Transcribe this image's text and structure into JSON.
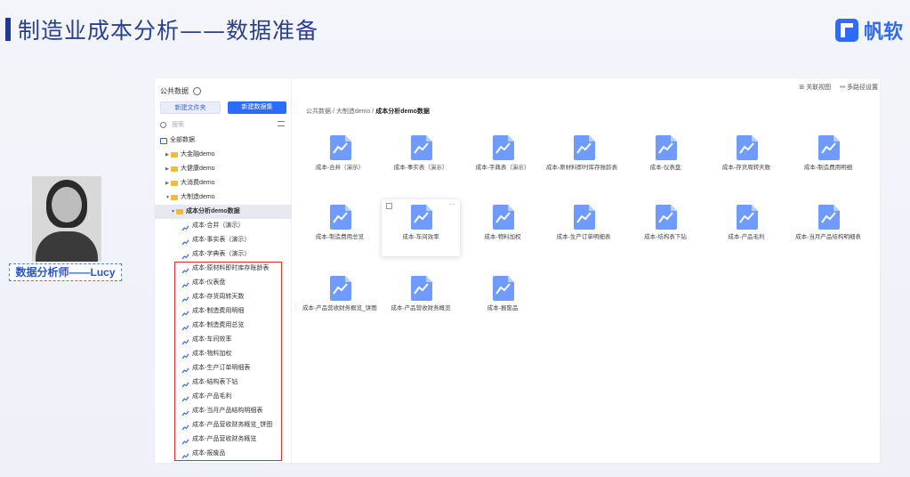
{
  "slide": {
    "title": "制造业成本分析——数据准备",
    "brand": "帆软"
  },
  "presenter": {
    "caption": "数据分析师——Lucy"
  },
  "sidebar": {
    "header": "公共数据",
    "btn_new_folder": "新建文件夹",
    "btn_new_dataset": "新建数据集",
    "search_placeholder": "搜索",
    "tree": [
      {
        "label": "全部数据",
        "level": 0,
        "type": "db"
      },
      {
        "label": "大金融demo",
        "level": 1,
        "type": "folder"
      },
      {
        "label": "大健康demo",
        "level": 1,
        "type": "folder"
      },
      {
        "label": "大消费demo",
        "level": 1,
        "type": "folder"
      },
      {
        "label": "大制造demo",
        "level": 1,
        "type": "folder",
        "open": true
      },
      {
        "label": "成本分析demo数据",
        "level": 2,
        "type": "folder",
        "open": true,
        "active": true
      },
      {
        "label": "成本-合并（演示）",
        "level": 3,
        "type": "table"
      },
      {
        "label": "成本-事实表（演示）",
        "level": 3,
        "type": "table"
      },
      {
        "label": "成本-字典表（演示）",
        "level": 3,
        "type": "table"
      },
      {
        "label": "成本-原材料即时库存账龄表",
        "level": 3,
        "type": "table"
      },
      {
        "label": "成本-仪表盘",
        "level": 3,
        "type": "table"
      },
      {
        "label": "成本-存货周转天数",
        "level": 3,
        "type": "table"
      },
      {
        "label": "成本-制造费用明细",
        "level": 3,
        "type": "table"
      },
      {
        "label": "成本-制造费用总览",
        "level": 3,
        "type": "table"
      },
      {
        "label": "成本-车间效率",
        "level": 3,
        "type": "table"
      },
      {
        "label": "成本-物料加权",
        "level": 3,
        "type": "table"
      },
      {
        "label": "成本-生产订单明细表",
        "level": 3,
        "type": "table"
      },
      {
        "label": "成本-结构表下钻",
        "level": 3,
        "type": "table"
      },
      {
        "label": "成本-产品毛利",
        "level": 3,
        "type": "table"
      },
      {
        "label": "成本-当月产品结构明细表",
        "level": 3,
        "type": "table"
      },
      {
        "label": "成本-产品营收财务概览_饼图",
        "level": 3,
        "type": "table"
      },
      {
        "label": "成本-产品营收财务概览",
        "level": 3,
        "type": "table"
      },
      {
        "label": "成本-报废品",
        "level": 3,
        "type": "table"
      }
    ]
  },
  "main": {
    "link_relation": "关联视图",
    "link_paths": "多路径设置",
    "breadcrumb": [
      "公共数据",
      "大制造demo",
      "成本分析demo数据"
    ],
    "tiles": [
      "成本-合并（演示）",
      "成本-事实表（演示）",
      "成本-字典表（演示）",
      "成本-原材料即时库存账龄表",
      "成本-仪表盘",
      "成本-存货周转天数",
      "成本-制造费用明细",
      "成本-制造费用总览",
      "成本-车间效率",
      "成本-物料加权",
      "成本-生产订单明细表",
      "成本-结构表下钻",
      "成本-产品毛利",
      "成本-当月产品结构明细表",
      "成本-产品营收财务概览_饼图",
      "成本-产品营收财务概览",
      "成本-报废品"
    ],
    "tile_more": "···"
  },
  "colors": {
    "brand": "#2d6bff",
    "highlight": "#e0302f",
    "title": "#2b3f8f"
  }
}
